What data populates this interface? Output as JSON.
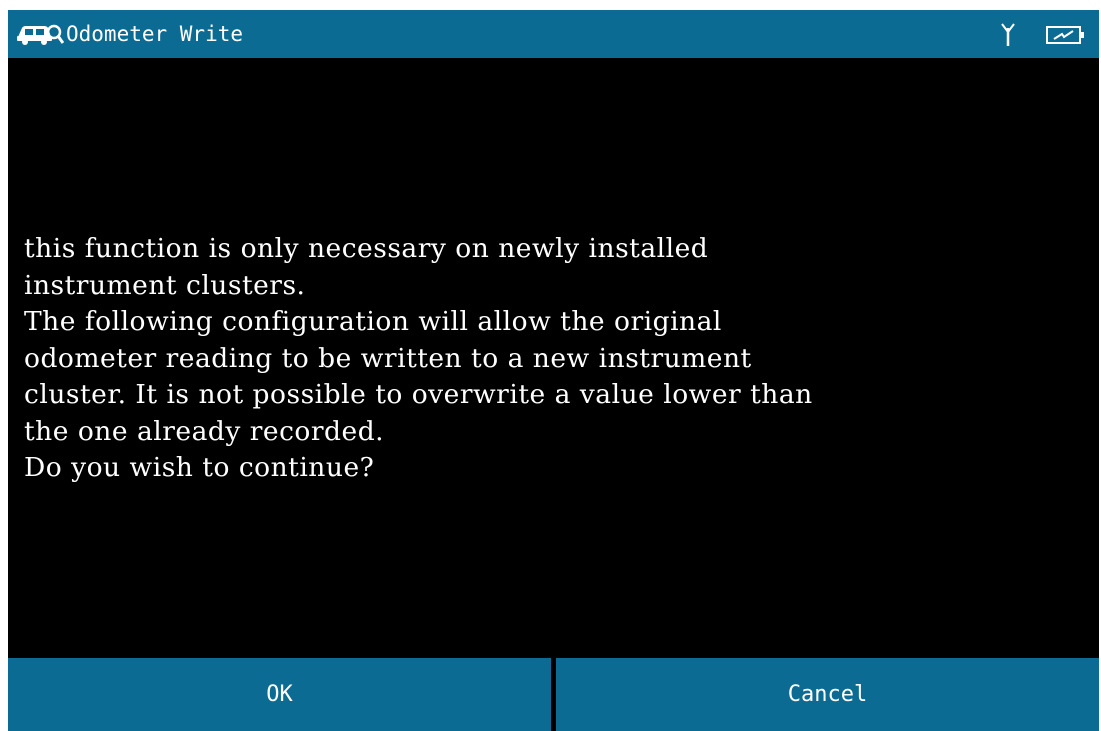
{
  "header": {
    "title": "Odometer Write",
    "app_icon": "car-diagnostic-icon",
    "status_icons": [
      "signal-antenna-icon",
      "battery-charging-icon"
    ]
  },
  "dialog": {
    "message": "this function is only necessary on newly installed\ninstrument clusters.\nThe following configuration will allow the original\nodometer reading to be written to a new instrument\ncluster. It is not possible to overwrite a value lower than\nthe one already recorded.\nDo you wish to continue?"
  },
  "buttons": {
    "ok_label": "OK",
    "cancel_label": "Cancel"
  },
  "colors": {
    "bar": "#0c6b93",
    "background": "#000000",
    "text": "#ffffff"
  }
}
